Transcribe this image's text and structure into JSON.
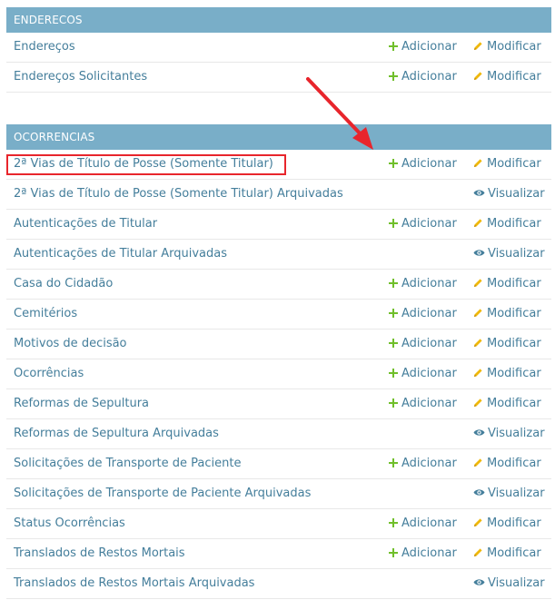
{
  "modules": [
    {
      "caption": "ENDERECOS",
      "rows": [
        {
          "name": "Endereços",
          "add": "Adicionar",
          "action": "Modificar",
          "action_icon": "pencil-icon"
        },
        {
          "name": "Endereços Solicitantes",
          "add": "Adicionar",
          "action": "Modificar",
          "action_icon": "pencil-icon"
        }
      ]
    },
    {
      "caption": "OCORRENCIAS",
      "rows": [
        {
          "name": "2ª Vias de Título de Posse (Somente Titular)",
          "add": "Adicionar",
          "action": "Modificar",
          "action_icon": "pencil-icon"
        },
        {
          "name": "2ª Vias de Título de Posse (Somente Titular) Arquivadas",
          "add": "",
          "action": "Visualizar",
          "action_icon": "eye-icon"
        },
        {
          "name": "Autenticações de Titular",
          "add": "Adicionar",
          "action": "Modificar",
          "action_icon": "pencil-icon"
        },
        {
          "name": "Autenticações de Titular Arquivadas",
          "add": "",
          "action": "Visualizar",
          "action_icon": "eye-icon"
        },
        {
          "name": "Casa do Cidadão",
          "add": "Adicionar",
          "action": "Modificar",
          "action_icon": "pencil-icon"
        },
        {
          "name": "Cemitérios",
          "add": "Adicionar",
          "action": "Modificar",
          "action_icon": "pencil-icon"
        },
        {
          "name": "Motivos de decisão",
          "add": "Adicionar",
          "action": "Modificar",
          "action_icon": "pencil-icon"
        },
        {
          "name": "Ocorrências",
          "add": "Adicionar",
          "action": "Modificar",
          "action_icon": "pencil-icon"
        },
        {
          "name": "Reformas de Sepultura",
          "add": "Adicionar",
          "action": "Modificar",
          "action_icon": "pencil-icon"
        },
        {
          "name": "Reformas de Sepultura Arquivadas",
          "add": "",
          "action": "Visualizar",
          "action_icon": "eye-icon"
        },
        {
          "name": "Solicitações de Transporte de Paciente",
          "add": "Adicionar",
          "action": "Modificar",
          "action_icon": "pencil-icon"
        },
        {
          "name": "Solicitações de Transporte de Paciente Arquivadas",
          "add": "",
          "action": "Visualizar",
          "action_icon": "eye-icon"
        },
        {
          "name": "Status Ocorrências",
          "add": "Adicionar",
          "action": "Modificar",
          "action_icon": "pencil-icon"
        },
        {
          "name": "Translados de Restos Mortais",
          "add": "Adicionar",
          "action": "Modificar",
          "action_icon": "pencil-icon"
        },
        {
          "name": "Translados de Restos Mortais Arquivadas",
          "add": "",
          "action": "Visualizar",
          "action_icon": "eye-icon"
        }
      ]
    }
  ],
  "colors": {
    "caption_bg": "#79aec8",
    "link": "#447e9b",
    "add_icon": "#70bf2b",
    "pencil_icon": "#efb80b",
    "eye_icon": "#447e9b",
    "annotation_red": "#e8252c"
  }
}
